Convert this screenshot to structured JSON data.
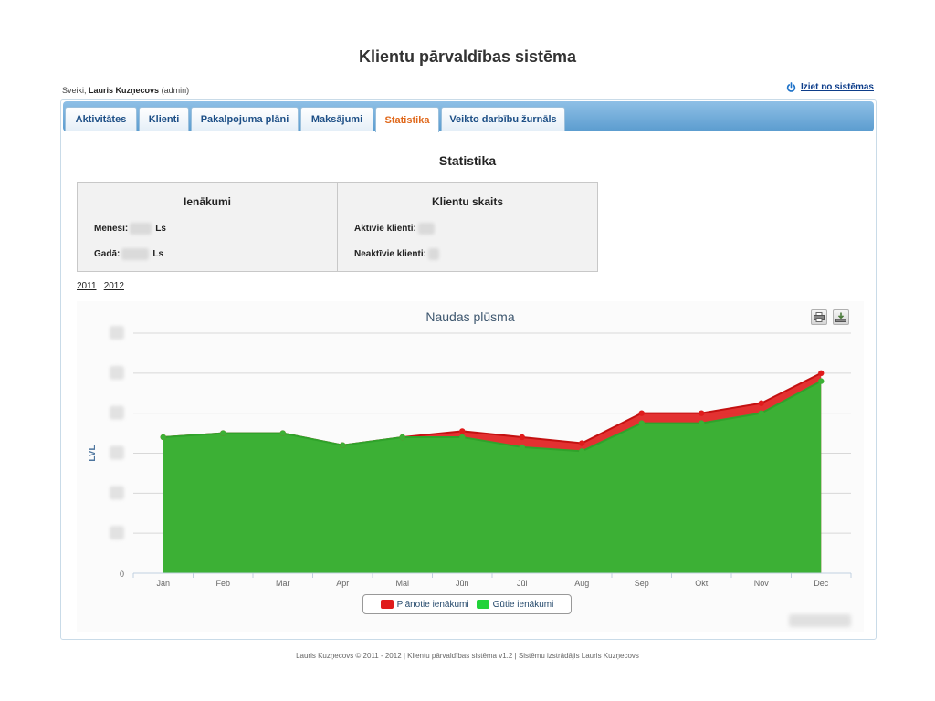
{
  "app": {
    "title": "Klientu pārvaldības sistēma"
  },
  "user": {
    "greeting": "Sveiki,",
    "name": "Lauris Kuzņecovs",
    "role": "(admin)"
  },
  "logout": {
    "label": "Iziet no sistēmas",
    "icon": "power-icon"
  },
  "tabs": [
    {
      "label": "Aktivitātes"
    },
    {
      "label": "Klienti"
    },
    {
      "label": "Pakalpojuma plāni"
    },
    {
      "label": "Maksājumi"
    },
    {
      "label": "Statistika",
      "active": true
    },
    {
      "label": "Veikto darbību žurnāls"
    }
  ],
  "page": {
    "title": "Statistika"
  },
  "income": {
    "title": "Ienākumi",
    "month_label": "Mēnesī:",
    "year_label": "Gadā:",
    "currency": "Ls"
  },
  "clients": {
    "title": "Klientu skaits",
    "active_label": "Aktīvie klienti:",
    "inactive_label": "Neaktīvie klienti:"
  },
  "years": {
    "y2011": "2011",
    "separator": "|",
    "y2012": "2012"
  },
  "chart_data": {
    "type": "area",
    "title": "Naudas plūsma",
    "ylabel": "LVL",
    "ylim": [
      0,
      6
    ],
    "y_ticks_visible": [
      "0"
    ],
    "categories": [
      "Jan",
      "Feb",
      "Mar",
      "Apr",
      "Mai",
      "Jūn",
      "Jūl",
      "Aug",
      "Sep",
      "Okt",
      "Nov",
      "Dec"
    ],
    "series": [
      {
        "name": "Plānotie ienākumi",
        "color": "#e01b1b",
        "values": [
          3.4,
          3.5,
          3.5,
          3.2,
          3.4,
          3.55,
          3.4,
          3.25,
          4.0,
          4.0,
          4.25,
          5.0
        ]
      },
      {
        "name": "Gūtie ienākumi",
        "color": "#3cb035",
        "values": [
          3.4,
          3.5,
          3.5,
          3.2,
          3.4,
          3.4,
          3.15,
          3.05,
          3.75,
          3.75,
          4.0,
          4.8
        ]
      }
    ],
    "legend_position": "bottom-center",
    "grid": true
  },
  "footer": {
    "text": "Lauris Kuzņecovs © 2011 - 2012 | Klientu pārvaldības sistēma v1.2 | Sistēmu izstrādājis Lauris Kuzņecovs"
  }
}
